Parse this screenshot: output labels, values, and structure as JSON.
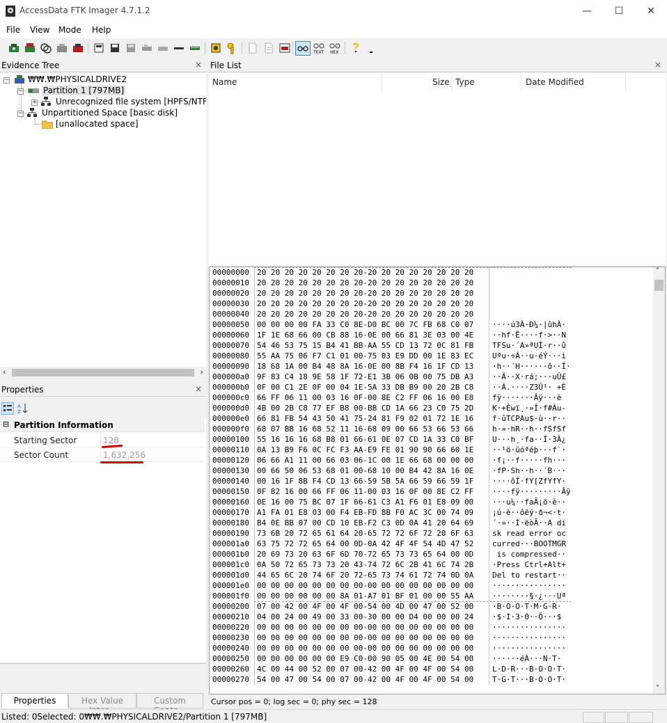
{
  "window": {
    "title": "AccessData FTK Imager 4.7.1.2",
    "minimize_glyph": "—",
    "maximize_glyph": "☐",
    "close_glyph": "✕"
  },
  "menu": [
    "File",
    "View",
    "Mode",
    "Help"
  ],
  "evidence_tree": {
    "title": "Evidence Tree",
    "close_glyph": "×",
    "root": "₩₩.₩PHYSICALDRIVE2",
    "partition1": "Partition 1 [797MB]",
    "unrecognized": "Unrecognized file system [HPFS/NTF",
    "unpartitioned": "Unpartitioned Space [basic disk]",
    "unallocated": "[unallocated space]"
  },
  "properties": {
    "title": "Properties",
    "close_glyph": "×",
    "category": "Partition Information",
    "rows": [
      {
        "name": "Starting Sector",
        "value": "128"
      },
      {
        "name": "Sector Count",
        "value": "1,632,256"
      }
    ],
    "tabs": [
      "Properties",
      "Hex Value Inter...",
      "Custom Conte..."
    ]
  },
  "file_list": {
    "title": "File List",
    "close_glyph": "×",
    "columns": [
      "Name",
      "Size",
      "Type",
      "Date Modified"
    ]
  },
  "hex": {
    "rows": [
      {
        "offset": "00000000",
        "bytes": "20 20 20 20 20 20 20 20-20 20 20 20 20 20 20 20",
        "ascii": ""
      },
      {
        "offset": "00000010",
        "bytes": "20 20 20 20 20 20 20 20-20 20 20 20 20 20 20 20",
        "ascii": ""
      },
      {
        "offset": "00000020",
        "bytes": "20 20 20 20 20 20 20 20-20 20 20 20 20 20 20 20",
        "ascii": ""
      },
      {
        "offset": "00000030",
        "bytes": "20 20 20 20 20 20 20 20-20 20 20 20 20 20 20 20",
        "ascii": ""
      },
      {
        "offset": "00000040",
        "bytes": "20 20 20 20 20 20 20 20-20 20 20 20 20 20 20 20",
        "ascii": ""
      },
      {
        "offset": "00000050",
        "bytes": "00 00 00 00 FA 33 C0 8E-D0 BC 00 7C FB 68 C0 07",
        "ascii": "····ú3À·Ð¼·|ûhÀ·"
      },
      {
        "offset": "00000060",
        "bytes": "1F 1E 68 66 00 CB 88 16-0E 00 66 81 3E 03 00 4E",
        "ascii": "··hf·Ë····f·>··N"
      },
      {
        "offset": "00000070",
        "bytes": "54 46 53 75 15 B4 41 BB-AA 55 CD 13 72 0C 81 FB",
        "ascii": "TFSu·´A»ªUÍ·r··û"
      },
      {
        "offset": "00000080",
        "bytes": "55 AA 75 06 F7 C1 01 00-75 03 E9 DD 00 1E 83 EC",
        "ascii": "Uªu·÷Á··u·éÝ···ì"
      },
      {
        "offset": "00000090",
        "bytes": "18 68 1A 00 B4 48 8A 16-0E 00 8B F4 16 1F CD 13",
        "ascii": "·h··´H······ô··Í·"
      },
      {
        "offset": "000000a0",
        "bytes": "9F 83 C4 18 9E 58 1F 72-E1 3B 06 0B 00 75 DB A3",
        "ascii": "··Ä··X·rá;···uÛ£"
      },
      {
        "offset": "000000b0",
        "bytes": "0F 00 C1 2E 0F 00 04 1E-5A 33 DB B9 00 20 2B C8",
        "ascii": "··Á.····Z3Û¹· +È"
      },
      {
        "offset": "000000c0",
        "bytes": "66 FF 06 11 00 03 16 0F-00 8E C2 FF 06 16 00 E8",
        "ascii": "fÿ·······Âÿ···è"
      },
      {
        "offset": "000000d0",
        "bytes": "4B 00 2B C8 77 EF B8 00-BB CD 1A 66 23 C0 75 2D",
        "ascii": "K·+Èwï¸·»Í·f#Àu-"
      },
      {
        "offset": "000000e0",
        "bytes": "66 81 FB 54 43 50 41 75-24 81 F9 02 01 72 1E 16",
        "ascii": "f·ûTCPAu$·ù··r··"
      },
      {
        "offset": "000000f0",
        "bytes": "68 07 BB 16 68 52 11 16-68 09 00 66 53 66 53 66",
        "ascii": "h·»·hR··h··fSfSf"
      },
      {
        "offset": "00000100",
        "bytes": "55 16 16 16 68 B8 01 66-61 0E 07 CD 1A 33 C0 BF",
        "ascii": "U···h¸·fa··Í·3À¿"
      },
      {
        "offset": "00000110",
        "bytes": "0A 13 B9 F6 0C FC F3 AA-E9 FE 01 90 90 66 60 1E",
        "ascii": "··¹ö·üóªéþ···f`·"
      },
      {
        "offset": "00000120",
        "bytes": "06 66 A1 11 00 66 03 06-1C 00 1E 66 68 00 00 00",
        "ascii": "·f¡··f·····fh···"
      },
      {
        "offset": "00000130",
        "bytes": "00 66 50 06 53 68 01 00-68 10 00 B4 42 8A 16 0E",
        "ascii": "·fP·Sh··h··´B···"
      },
      {
        "offset": "00000140",
        "bytes": "00 16 1F 8B F4 CD 13 66-59 5B 5A 66 59 66 59 1F",
        "ascii": "····ôÍ·fY[ZfYfY·"
      },
      {
        "offset": "00000150",
        "bytes": "0F 82 16 00 66 FF 06 11-00 03 16 0F 00 8E C2 FF",
        "ascii": "····fÿ·········Âÿ"
      },
      {
        "offset": "00000160",
        "bytes": "0E 16 00 75 BC 07 1F 66-61 C3 A1 F6 01 E8 09 00",
        "ascii": "···u¼··faÃ¡ö·è··"
      },
      {
        "offset": "00000170",
        "bytes": "A1 FA 01 E8 03 00 F4 EB-FD 8B F0 AC 3C 00 74 09",
        "ascii": "¡ú·è··ôëý·ð¬<·t·"
      },
      {
        "offset": "00000180",
        "bytes": "B4 0E BB 07 00 CD 10 EB-F2 C3 0D 0A 41 20 64 69",
        "ascii": "´·»··Í·ëòÃ··A di"
      },
      {
        "offset": "00000190",
        "bytes": "73 6B 20 72 65 61 64 20-65 72 72 6F 72 20 6F 63",
        "ascii": "sk read error oc"
      },
      {
        "offset": "000001a0",
        "bytes": "63 75 72 72 65 64 00 0D-0A 42 4F 4F 54 4D 47 52",
        "ascii": "curred···BOOTMGR"
      },
      {
        "offset": "000001b0",
        "bytes": "20 69 73 20 63 6F 6D 70-72 65 73 73 65 64 00 0D",
        "ascii": " is compressed··"
      },
      {
        "offset": "000001c0",
        "bytes": "0A 50 72 65 73 73 20 43-74 72 6C 2B 41 6C 74 2B",
        "ascii": "·Press Ctrl+Alt+"
      },
      {
        "offset": "000001d0",
        "bytes": "44 65 6C 20 74 6F 20 72-65 73 74 61 72 74 0D 0A",
        "ascii": "Del to restart··"
      },
      {
        "offset": "000001e0",
        "bytes": "00 00 00 00 00 00 00 00-00 00 00 00 00 00 00 00",
        "ascii": "················"
      },
      {
        "offset": "000001f0",
        "bytes": "00 00 00 00 00 00 8A 01-A7 01 BF 01 00 00 55 AA",
        "ascii": "········§·¿···Uª"
      },
      {
        "offset": "00000200",
        "bytes": "07 00 42 00 4F 00 4F 00-54 00 4D 00 47 00 52 00",
        "ascii": "·B·O·O·T·M·G·R·"
      },
      {
        "offset": "00000210",
        "bytes": "04 00 24 00 49 00 33 00-30 00 00 D4 00 00 00 24",
        "ascii": "·$·I·3·0··Ô···$"
      },
      {
        "offset": "00000220",
        "bytes": "00 00 00 00 00 00 00 00-00 00 00 00 00 00 00 00",
        "ascii": "················"
      },
      {
        "offset": "00000230",
        "bytes": "00 00 00 00 00 00 00 00-00 00 00 00 00 00 00 00",
        "ascii": "················"
      },
      {
        "offset": "00000240",
        "bytes": "00 00 00 00 00 00 00 00-00 00 00 00 00 00 00 00",
        "ascii": "················"
      },
      {
        "offset": "00000250",
        "bytes": "00 00 00 00 00 00 E9 C0-00 90 05 00 4E 00 54 00",
        "ascii": "······éÀ···N·T·"
      },
      {
        "offset": "00000260",
        "bytes": "4C 00 44 00 52 00 07 00-42 00 4F 00 4F 00 54 00",
        "ascii": "L·D·R···B·O·O·T·"
      },
      {
        "offset": "00000270",
        "bytes": "54 00 47 00 54 00 07 00-42 00 4F 00 4F 00 54 00",
        "ascii": "T·G·T···B·O·O·T·"
      }
    ],
    "status": "Cursor pos = 0; log sec = 0; phy sec = 128"
  },
  "statusbar": {
    "text": "Listed: 0Selected: 0₩₩.₩PHYSICALDRIVE2/Partition 1 [797MB]"
  }
}
